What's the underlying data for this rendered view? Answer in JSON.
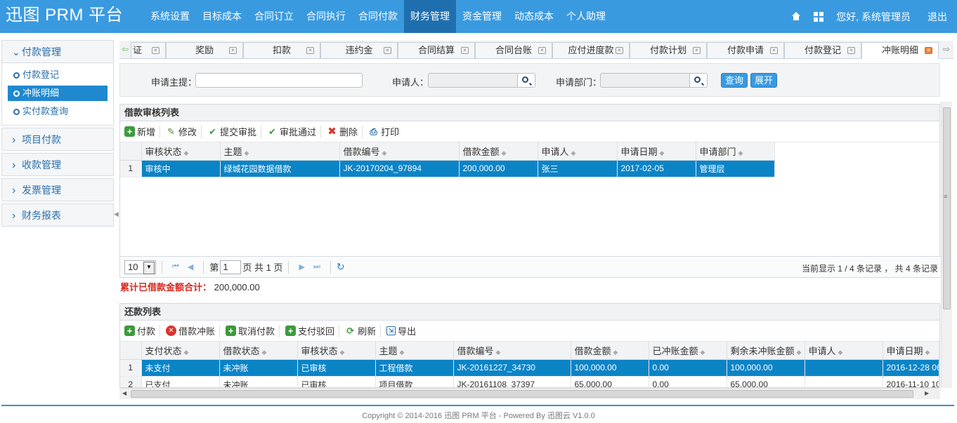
{
  "header": {
    "logo": "迅图 PRM 平台",
    "nav": [
      "系统设置",
      "目标成本",
      "合同订立",
      "合同执行",
      "合同付款",
      "财务管理",
      "资金管理",
      "动态成本",
      "个人助理"
    ],
    "active_nav": 5,
    "greeting": "您好, 系统管理员",
    "logout": "退出"
  },
  "sidebar": {
    "groups": [
      {
        "label": "付款管理",
        "expanded": true,
        "items": [
          "付款登记",
          "冲账明细",
          "实付款查询"
        ],
        "active_item": 1
      },
      {
        "label": "项目付款"
      },
      {
        "label": "收款管理"
      },
      {
        "label": "发票管理"
      },
      {
        "label": "财务报表"
      }
    ]
  },
  "tabs": [
    "证",
    "奖励",
    "扣款",
    "违约金",
    "合同结算",
    "合同台账",
    "应付进度款",
    "付款计划",
    "付款申请",
    "付款登记",
    "冲账明细"
  ],
  "active_tab": 10,
  "search": {
    "subject_label": "申请主提：",
    "applicant_label": "申请人：",
    "dept_label": "申请部门：",
    "query_btn": "查询",
    "expand_btn": "展开"
  },
  "loan_panel": {
    "title": "借款审核列表",
    "toolbar": [
      "新增",
      "修改",
      "提交审批",
      "审批通过",
      "删除",
      "打印"
    ],
    "columns": [
      "审核状态",
      "主题",
      "借款编号",
      "借款金额",
      "申请人",
      "申请日期",
      "申请部门"
    ],
    "rows": [
      {
        "no": "1",
        "cells": [
          "审核中",
          "绿城花园数据借款",
          "JK-20170204_97894",
          "200,000.00",
          "张三",
          "2017-02-05",
          "管理层"
        ]
      }
    ],
    "pager": {
      "page_size": "10",
      "page_label_pre": "第",
      "page": "1",
      "page_label_post": "页 共 1 页",
      "info": "当前显示 1 / 4 条记录 ， 共 4 条记录"
    }
  },
  "total": {
    "label": "累计已借款金额合计：",
    "value": "200,000.00"
  },
  "repay_panel": {
    "title": "还款列表",
    "toolbar": [
      "付款",
      "借款冲账",
      "取消付款",
      "支付驳回",
      "刷新",
      "导出"
    ],
    "columns": [
      "支付状态",
      "借款状态",
      "审核状态",
      "主题",
      "借款编号",
      "借款金额",
      "已冲账金额",
      "剩余未冲账金额",
      "申请人",
      "申请日期"
    ],
    "rows": [
      {
        "no": "1",
        "cells": [
          "未支付",
          "未冲账",
          "已审核",
          "工程借款",
          "JK-20161227_34730",
          "100,000.00",
          "0.00",
          "100,000.00",
          "",
          "2016-12-28 06"
        ]
      },
      {
        "no": "2",
        "cells": [
          "已支付",
          "未冲账",
          "已审核",
          "项目借款",
          "JK-20161108_37397",
          "65,000.00",
          "0.00",
          "65,000.00",
          "",
          "2016-11-10 10"
        ]
      }
    ]
  },
  "footer": "Copyright © 2014-2016 迅图 PRM 平台 - Powered By 迅图云 V1.0.0"
}
